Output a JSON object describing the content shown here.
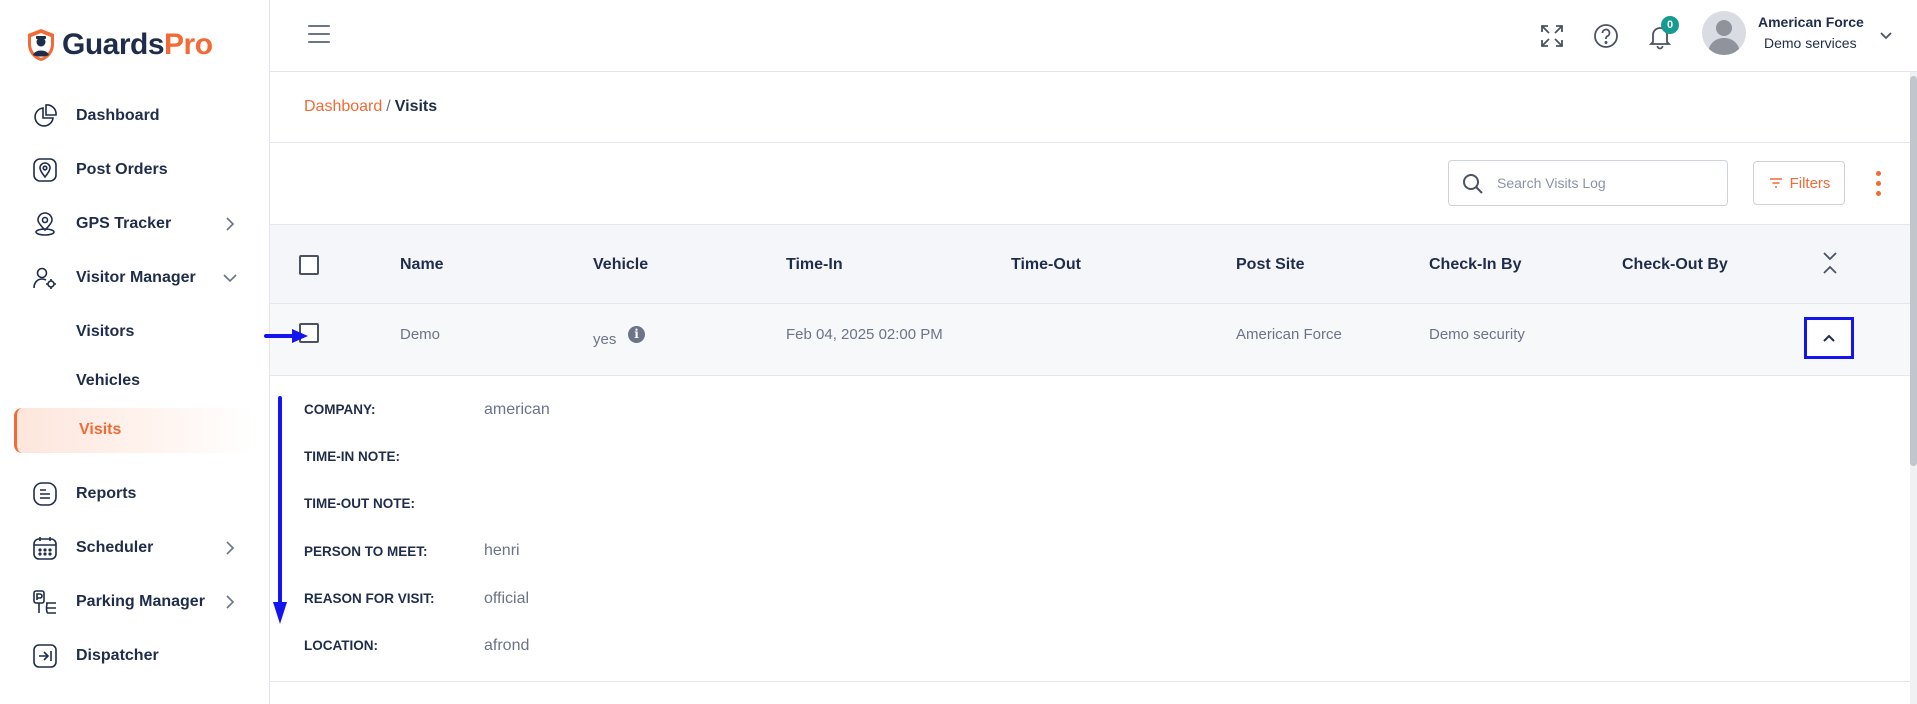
{
  "brand": {
    "name_part1": "Guards",
    "name_part2": "Pro",
    "accent": "#f26a36",
    "text": "#1f2d4a"
  },
  "sidebar": {
    "items": [
      {
        "label": "Dashboard",
        "icon": "pie-chart-icon"
      },
      {
        "label": "Post Orders",
        "icon": "location-pin-icon"
      },
      {
        "label": "GPS Tracker",
        "icon": "gps-pin-icon"
      },
      {
        "label": "Visitor Manager",
        "icon": "user-gear-icon"
      },
      {
        "label": "Reports",
        "icon": "document-icon"
      },
      {
        "label": "Scheduler",
        "icon": "calendar-icon"
      },
      {
        "label": "Parking Manager",
        "icon": "parking-icon"
      },
      {
        "label": "Dispatcher",
        "icon": "dispatch-icon"
      }
    ],
    "visitor_subitems": [
      "Visitors",
      "Vehicles",
      "Visits"
    ],
    "active_subitem": "Visits"
  },
  "topbar": {
    "notification_count": "0",
    "user_name": "American Force",
    "user_org": "Demo services"
  },
  "breadcrumb": {
    "parent": "Dashboard",
    "separator": "/",
    "current": "Visits"
  },
  "toolbar": {
    "search_placeholder": "Search Visits Log",
    "filters_label": "Filters"
  },
  "table": {
    "columns": [
      "Name",
      "Vehicle",
      "Time-In",
      "Time-Out",
      "Post Site",
      "Check-In By",
      "Check-Out By"
    ],
    "rows": [
      {
        "name": "Demo",
        "vehicle": "yes",
        "time_in": "Feb 04, 2025 02:00 PM",
        "time_out": "",
        "post_site": "American Force",
        "check_in_by": "Demo security",
        "check_out_by": ""
      }
    ]
  },
  "details": [
    {
      "label": "COMPANY:",
      "value": "american"
    },
    {
      "label": "TIME-IN NOTE:",
      "value": ""
    },
    {
      "label": "TIME-OUT NOTE:",
      "value": ""
    },
    {
      "label": "PERSON TO MEET:",
      "value": "henri"
    },
    {
      "label": "REASON FOR VISIT:",
      "value": "official"
    },
    {
      "label": "LOCATION:",
      "value": "afrond"
    }
  ],
  "annotation_color": "#1414ee"
}
